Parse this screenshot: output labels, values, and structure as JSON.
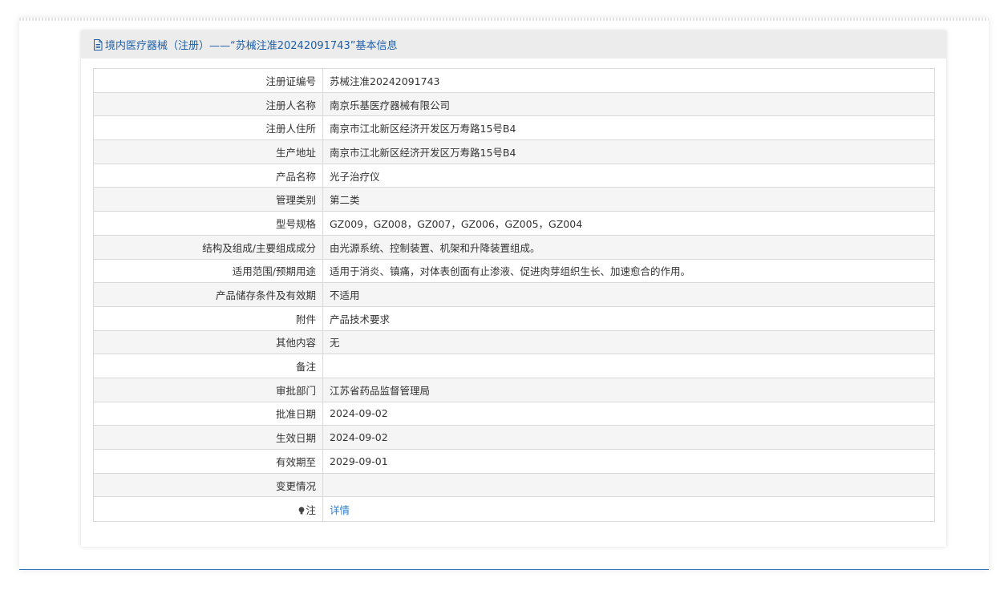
{
  "header": {
    "title": "境内医疗器械（注册）——“苏械注准20242091743”基本信息",
    "icon": "document-icon",
    "accent_color": "#1f5fa9"
  },
  "rows": [
    {
      "label": "注册证编号",
      "value": "苏械注准20242091743"
    },
    {
      "label": "注册人名称",
      "value": "南京乐基医疗器械有限公司"
    },
    {
      "label": "注册人住所",
      "value": "南京市江北新区经济开发区万寿路15号B4"
    },
    {
      "label": "生产地址",
      "value": "南京市江北新区经济开发区万寿路15号B4"
    },
    {
      "label": "产品名称",
      "value": "光子治疗仪"
    },
    {
      "label": "管理类别",
      "value": "第二类"
    },
    {
      "label": "型号规格",
      "value": "GZ009，GZ008，GZ007，GZ006，GZ005，GZ004"
    },
    {
      "label": "结构及组成/主要组成成分",
      "value": "由光源系统、控制装置、机架和升降装置组成。"
    },
    {
      "label": "适用范围/预期用途",
      "value": "适用于消炎、镇痛，对体表创面有止渗液、促进肉芽组织生长、加速愈合的作用。"
    },
    {
      "label": "产品储存条件及有效期",
      "value": "不适用"
    },
    {
      "label": "附件",
      "value": "产品技术要求"
    },
    {
      "label": "其他内容",
      "value": "无"
    },
    {
      "label": "备注",
      "value": ""
    },
    {
      "label": "审批部门",
      "value": "江苏省药品监督管理局"
    },
    {
      "label": "批准日期",
      "value": "2024-09-02"
    },
    {
      "label": "生效日期",
      "value": "2024-09-02"
    },
    {
      "label": "有效期至",
      "value": "2029-09-01"
    },
    {
      "label": "变更情况",
      "value": ""
    }
  ],
  "note": {
    "icon": "bulb-icon",
    "label": "注",
    "link_text": "详情",
    "link_color": "#2a7fd4"
  }
}
